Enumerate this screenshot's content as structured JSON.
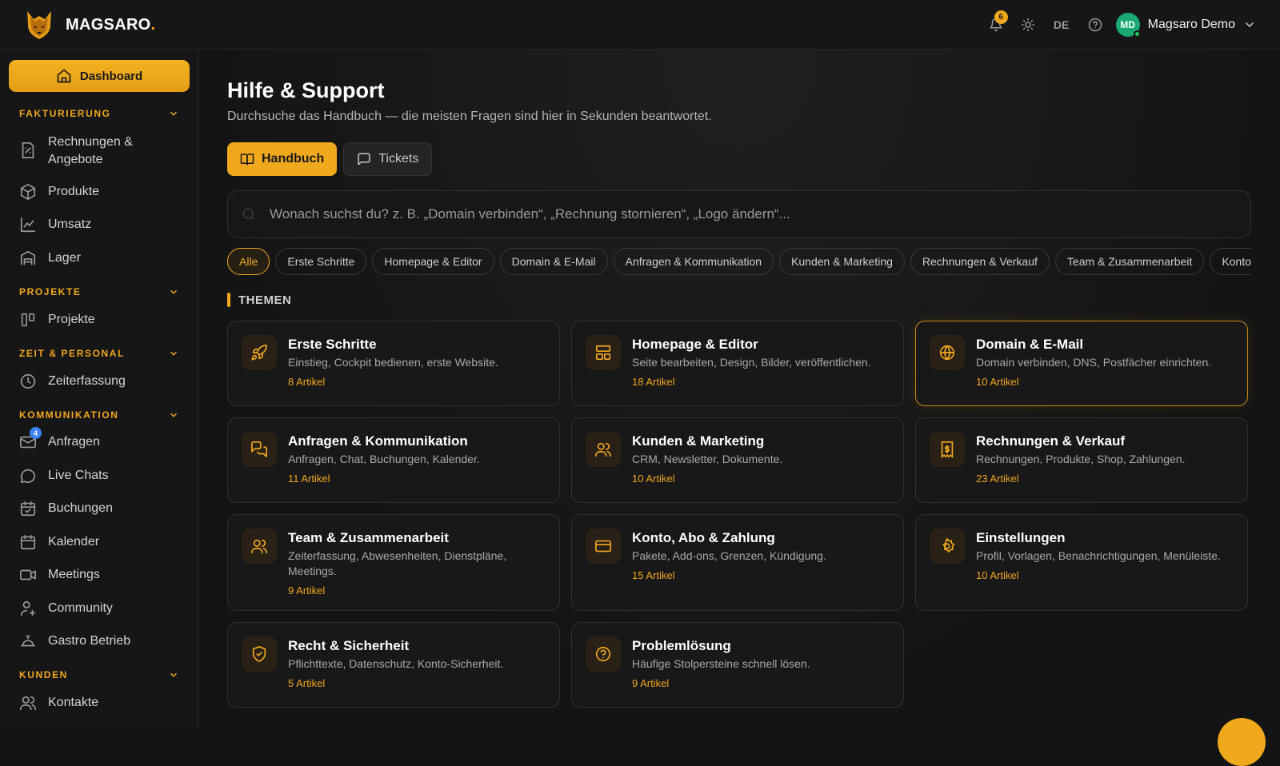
{
  "brand": {
    "name": "MAGSARO",
    "dot": "."
  },
  "topbar": {
    "notifications_count": "6",
    "language": "DE",
    "user_initials": "MD",
    "user_name": "Magsaro Demo"
  },
  "sidebar": {
    "dashboard_label": "Dashboard",
    "sections": [
      {
        "title": "FAKTURIERUNG",
        "items": [
          {
            "label": "Rechnungen & Angebote",
            "icon": "invoice-icon"
          },
          {
            "label": "Produkte",
            "icon": "box-icon"
          },
          {
            "label": "Umsatz",
            "icon": "chart-line-icon"
          },
          {
            "label": "Lager",
            "icon": "warehouse-icon"
          }
        ]
      },
      {
        "title": "PROJEKTE",
        "items": [
          {
            "label": "Projekte",
            "icon": "kanban-icon"
          }
        ]
      },
      {
        "title": "ZEIT & PERSONAL",
        "items": [
          {
            "label": "Zeiterfassung",
            "icon": "clock-icon"
          }
        ]
      },
      {
        "title": "KOMMUNIKATION",
        "items": [
          {
            "label": "Anfragen",
            "icon": "mail-icon",
            "badge": "4"
          },
          {
            "label": "Live Chats",
            "icon": "chat-icon"
          },
          {
            "label": "Buchungen",
            "icon": "calendar-check-icon"
          },
          {
            "label": "Kalender",
            "icon": "calendar-icon"
          },
          {
            "label": "Meetings",
            "icon": "video-icon"
          },
          {
            "label": "Community",
            "icon": "community-icon"
          },
          {
            "label": "Gastro Betrieb",
            "icon": "cloche-icon"
          }
        ]
      },
      {
        "title": "KUNDEN",
        "items": [
          {
            "label": "Kontakte",
            "icon": "contacts-icon"
          }
        ]
      }
    ]
  },
  "main": {
    "title": "Hilfe & Support",
    "subtitle": "Durchsuche das Handbuch — die meisten Fragen sind hier in Sekunden beantwortet.",
    "tabs": [
      {
        "label": "Handbuch",
        "active": true
      },
      {
        "label": "Tickets",
        "active": false
      }
    ],
    "search_placeholder": "Wonach suchst du? z. B. „Domain verbinden“, „Rechnung stornieren“, „Logo ändern“...",
    "chips": [
      "Alle",
      "Erste Schritte",
      "Homepage & Editor",
      "Domain & E-Mail",
      "Anfragen & Kommunikation",
      "Kunden & Marketing",
      "Rechnungen & Verkauf",
      "Team & Zusammenarbeit",
      "Konto, Abo & Zahlung"
    ],
    "section_title": "THEMEN",
    "topics": [
      {
        "title": "Erste Schritte",
        "desc": "Einstieg, Cockpit bedienen, erste Website.",
        "count": "8 Artikel",
        "icon": "rocket-icon"
      },
      {
        "title": "Homepage & Editor",
        "desc": "Seite bearbeiten, Design, Bilder, veröffentlichen.",
        "count": "18 Artikel",
        "icon": "layout-icon"
      },
      {
        "title": "Domain & E-Mail",
        "desc": "Domain verbinden, DNS, Postfächer einrichten.",
        "count": "10 Artikel",
        "icon": "globe-icon"
      },
      {
        "title": "Anfragen & Kommunikation",
        "desc": "Anfragen, Chat, Buchungen, Kalender.",
        "count": "11 Artikel",
        "icon": "messages-icon"
      },
      {
        "title": "Kunden & Marketing",
        "desc": "CRM, Newsletter, Dokumente.",
        "count": "10 Artikel",
        "icon": "users-icon"
      },
      {
        "title": "Rechnungen & Verkauf",
        "desc": "Rechnungen, Produkte, Shop, Zahlungen.",
        "count": "23 Artikel",
        "icon": "receipt-icon"
      },
      {
        "title": "Team & Zusammenarbeit",
        "desc": "Zeiterfassung, Abwesenheiten, Dienstpläne, Meetings.",
        "count": "9 Artikel",
        "icon": "team-icon"
      },
      {
        "title": "Konto, Abo & Zahlung",
        "desc": "Pakete, Add-ons, Grenzen, Kündigung.",
        "count": "15 Artikel",
        "icon": "credit-card-icon"
      },
      {
        "title": "Einstellungen",
        "desc": "Profil, Vorlagen, Benachrichtigungen, Menüleiste.",
        "count": "10 Artikel",
        "icon": "gear-icon"
      },
      {
        "title": "Recht & Sicherheit",
        "desc": "Pflichttexte, Datenschutz, Konto-Sicherheit.",
        "count": "5 Artikel",
        "icon": "shield-icon"
      },
      {
        "title": "Problemlösung",
        "desc": "Häufige Stolpersteine schnell lösen.",
        "count": "9 Artikel",
        "icon": "help-circle-icon"
      }
    ]
  },
  "colors": {
    "accent": "#f0a81c",
    "background": "#141414",
    "avatar": "#1aa872",
    "badge_blue": "#3b82f6"
  }
}
